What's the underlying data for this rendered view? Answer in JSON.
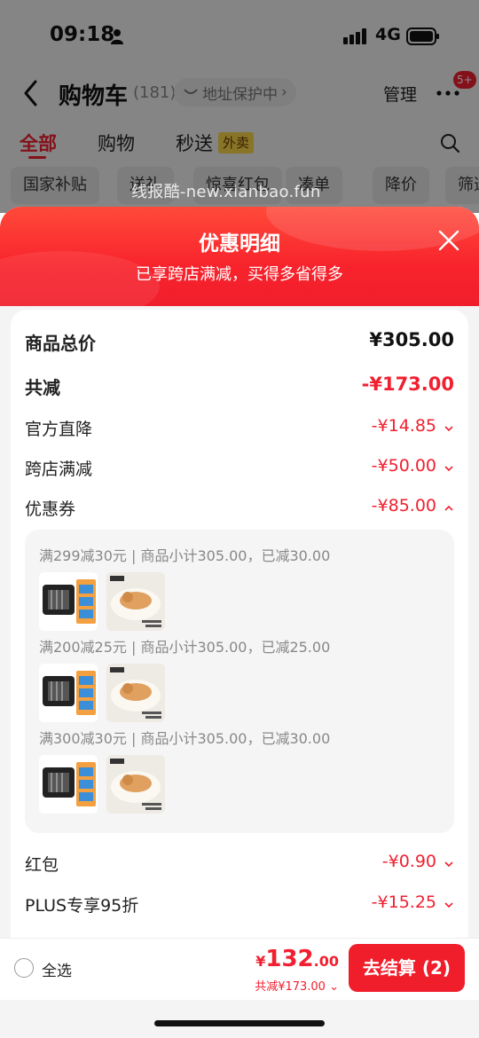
{
  "status_bar": {
    "time": "09:18",
    "network": "4G"
  },
  "nav": {
    "title": "购物车",
    "count": "(181)",
    "address_label": "地址保护中",
    "manage": "管理",
    "badge": "5+"
  },
  "tabs": [
    {
      "label": "全部"
    },
    {
      "label": "购物"
    },
    {
      "label": "秒送"
    }
  ],
  "tab_badge": "外卖",
  "chips": [
    "国家补贴",
    "送礼",
    "惊喜红包",
    "凑单",
    "降价",
    "筛选"
  ],
  "watermark": "线报酷-new.xianbao.fun",
  "sheet": {
    "title": "优惠明细",
    "subtitle": "已享跨店满减，买得多省得多",
    "rows": [
      {
        "label": "商品总价",
        "value": "¥305.00"
      },
      {
        "label": "共减",
        "value": "-¥173.00"
      },
      {
        "label": "官方直降",
        "value": "-¥14.85"
      },
      {
        "label": "跨店满减",
        "value": "-¥50.00"
      },
      {
        "label": "优惠券",
        "value": "-¥85.00"
      },
      {
        "label": "红包",
        "value": "-¥0.90"
      },
      {
        "label": "PLUS专享95折",
        "value": "-¥15.25"
      }
    ],
    "coupons": [
      {
        "text": "满299减30元 | 商品小计305.00，已减30.00"
      },
      {
        "text": "满200减25元 | 商品小计305.00，已减25.00"
      },
      {
        "text": "满300减30元 | 商品小计305.00，已减30.00"
      }
    ]
  },
  "bottom": {
    "select_all": "全选",
    "currency": "¥",
    "price_int": "132",
    "price_dec": ".00",
    "saved": "共减¥173.00",
    "checkout": "去结算 (2)"
  },
  "colors": {
    "accent": "#f02030",
    "badge_yellow": "#f7d64a"
  }
}
